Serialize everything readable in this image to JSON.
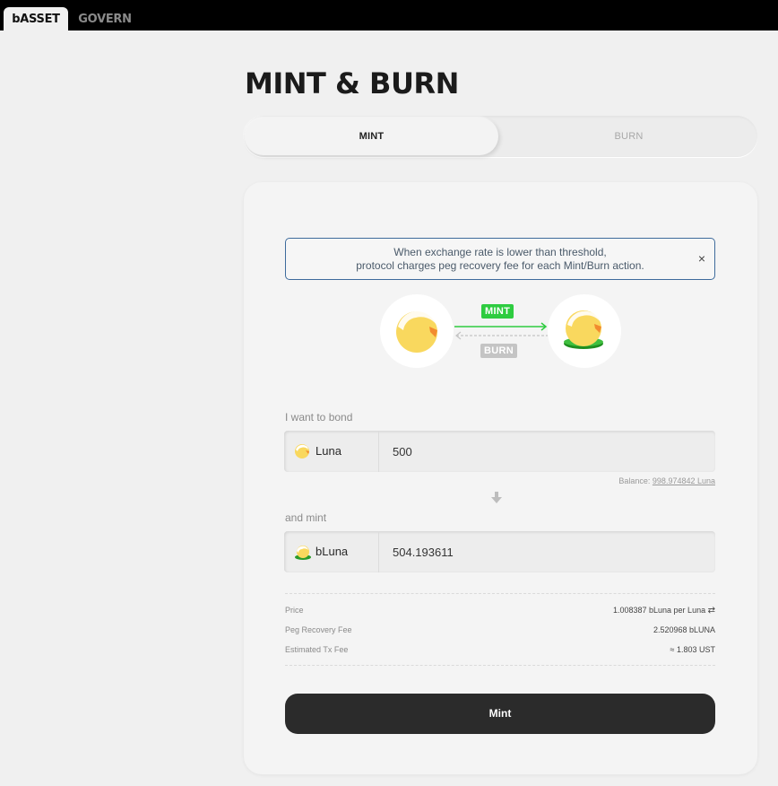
{
  "nav": {
    "tabs": [
      {
        "label": "bASSET"
      },
      {
        "label": "GOVERN"
      }
    ]
  },
  "page": {
    "title": "MINT & BURN"
  },
  "segment": {
    "mint_label": "MINT",
    "burn_label": "BURN",
    "active": "MINT"
  },
  "notice": {
    "line1": "When exchange rate is lower than threshold,",
    "line2": "protocol charges peg recovery fee for each Mint/Burn action.",
    "close": "×"
  },
  "diagram": {
    "mint_tag": "MINT",
    "burn_tag": "BURN",
    "mint_color": "#2ecc40",
    "burn_color": "#c4c4c4"
  },
  "bond": {
    "label": "I want to bond",
    "asset": "Luna",
    "amount": "500"
  },
  "balance": {
    "prefix": "Balance:",
    "value": "998.974842 Luna"
  },
  "mint": {
    "label": "and mint",
    "asset": "bLuna",
    "amount": "504.193611"
  },
  "summary": {
    "rows": [
      {
        "key": "Price",
        "value": "1.008387 bLuna per Luna"
      },
      {
        "key": "Peg Recovery Fee",
        "value": "2.520968 bLUNA"
      },
      {
        "key": "Estimated Tx Fee",
        "value": "≈ 1.803 UST"
      }
    ]
  },
  "action": {
    "button_label": "Mint"
  },
  "colors": {
    "accent": "#2b2b2b",
    "luna_yellow": "#f9d85e",
    "luna_orange": "#f28b2e",
    "notice_border": "#3e6b9c"
  }
}
